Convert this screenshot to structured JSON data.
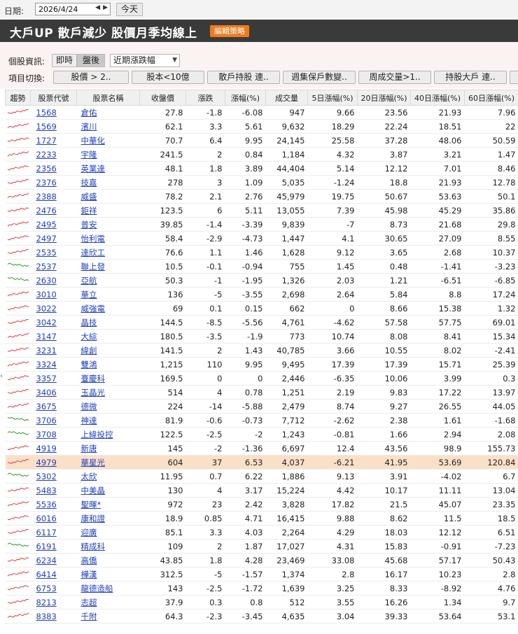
{
  "datebar": {
    "label": "日期:",
    "date": "2026/4/24",
    "today": "今天"
  },
  "title": {
    "text": "大戶UP 散戶減少 股價月季均線上",
    "edit": "編輯策略"
  },
  "info": {
    "label": "個股資訊:",
    "realtime": "即時",
    "afterhours": "盤後",
    "select": "近期漲跌幅"
  },
  "switch": {
    "label": "項目切換:",
    "buttons": [
      "股價 > 2..",
      "股本<10億",
      "散戶持股 連..",
      "週集保戶數變..",
      "周成交量>1..",
      "持股大戶 連.."
    ]
  },
  "columns": [
    "趨勢",
    "股票代號",
    "股票名稱",
    "收盤價",
    "漲跌",
    "漲幅(%)",
    "成交量",
    "5日漲幅(%)",
    "20日漲幅(%)",
    "40日漲幅(%)",
    "60日漲幅(%)"
  ],
  "colors": {
    "up": "#e23a3a",
    "down": "#2a9a2a",
    "highlight": "#fbe0c8",
    "accent": "#f07a1c"
  },
  "rows": [
    {
      "code": "1568",
      "name": "倉佑",
      "close": "27.8",
      "chg": "-1.8",
      "pct": "-6.08",
      "vol": "947",
      "d5": "9.66",
      "d20": "23.56",
      "d40": "21.93",
      "d60": "7.96",
      "trend": "up"
    },
    {
      "code": "1569",
      "name": "濱川",
      "close": "62.1",
      "chg": "3.3",
      "pct": "5.61",
      "vol": "9,632",
      "d5": "18.29",
      "d20": "22.24",
      "d40": "18.51",
      "d60": "22",
      "trend": "up"
    },
    {
      "code": "1727",
      "name": "中華化",
      "close": "70.7",
      "chg": "6.4",
      "pct": "9.95",
      "vol": "24,145",
      "d5": "25.58",
      "d20": "37.28",
      "d40": "48.06",
      "d60": "50.59",
      "trend": "up"
    },
    {
      "code": "2233",
      "name": "宇隆",
      "close": "241.5",
      "chg": "2",
      "pct": "0.84",
      "vol": "1,184",
      "d5": "4.32",
      "d20": "3.87",
      "d40": "3.21",
      "d60": "1.47",
      "trend": "up"
    },
    {
      "code": "2356",
      "name": "英業達",
      "close": "48.1",
      "chg": "1.8",
      "pct": "3.89",
      "vol": "44,404",
      "d5": "5.14",
      "d20": "12.12",
      "d40": "7.01",
      "d60": "8.46",
      "trend": "up"
    },
    {
      "code": "2376",
      "name": "技嘉",
      "close": "278",
      "chg": "3",
      "pct": "1.09",
      "vol": "5,035",
      "d5": "-1.24",
      "d20": "18.8",
      "d40": "21.93",
      "d60": "12.78",
      "trend": "up"
    },
    {
      "code": "2388",
      "name": "威盛",
      "close": "78.2",
      "chg": "2.1",
      "pct": "2.76",
      "vol": "45,979",
      "d5": "19.75",
      "d20": "50.67",
      "d40": "53.63",
      "d60": "50.1",
      "trend": "up"
    },
    {
      "code": "2476",
      "name": "鉅祥",
      "close": "123.5",
      "chg": "6",
      "pct": "5.11",
      "vol": "13,055",
      "d5": "7.39",
      "d20": "45.98",
      "d40": "45.29",
      "d60": "35.86",
      "trend": "up"
    },
    {
      "code": "2495",
      "name": "普安",
      "close": "39.85",
      "chg": "-1.4",
      "pct": "-3.39",
      "vol": "9,839",
      "d5": "-7",
      "d20": "8.73",
      "d40": "21.68",
      "d60": "29.8",
      "trend": "up"
    },
    {
      "code": "2497",
      "name": "怡利電",
      "close": "58.4",
      "chg": "-2.9",
      "pct": "-4.73",
      "vol": "1,447",
      "d5": "4.1",
      "d20": "30.65",
      "d40": "27.09",
      "d60": "8.55",
      "trend": "up"
    },
    {
      "code": "2535",
      "name": "達欣工",
      "close": "76.6",
      "chg": "1.1",
      "pct": "1.46",
      "vol": "1,628",
      "d5": "9.12",
      "d20": "3.65",
      "d40": "2.68",
      "d60": "10.37",
      "trend": "up"
    },
    {
      "code": "2537",
      "name": "聯上發",
      "close": "10.5",
      "chg": "-0.1",
      "pct": "-0.94",
      "vol": "755",
      "d5": "1.45",
      "d20": "0.48",
      "d40": "-1.41",
      "d60": "-3.23",
      "trend": "down"
    },
    {
      "code": "2630",
      "name": "亞航",
      "close": "50.3",
      "chg": "-1",
      "pct": "-1.95",
      "vol": "1,326",
      "d5": "2.03",
      "d20": "1.21",
      "d40": "-6.51",
      "d60": "-6.85",
      "trend": "down"
    },
    {
      "code": "3010",
      "name": "華立",
      "close": "136",
      "chg": "-5",
      "pct": "-3.55",
      "vol": "2,698",
      "d5": "2.64",
      "d20": "5.84",
      "d40": "8.8",
      "d60": "17.24",
      "trend": "up"
    },
    {
      "code": "3022",
      "name": "威強電",
      "close": "69",
      "chg": "0.1",
      "pct": "0.15",
      "vol": "662",
      "d5": "0",
      "d20": "8.66",
      "d40": "15.38",
      "d60": "1.32",
      "trend": "up"
    },
    {
      "code": "3042",
      "name": "晶技",
      "close": "144.5",
      "chg": "-8.5",
      "pct": "-5.56",
      "vol": "4,761",
      "d5": "-4.62",
      "d20": "57.58",
      "d40": "57.75",
      "d60": "69.01",
      "trend": "up"
    },
    {
      "code": "3147",
      "name": "大綜",
      "close": "180.5",
      "chg": "-3.5",
      "pct": "-1.9",
      "vol": "773",
      "d5": "10.74",
      "d20": "8.08",
      "d40": "8.41",
      "d60": "15.34",
      "trend": "up"
    },
    {
      "code": "3231",
      "name": "緯創",
      "close": "141.5",
      "chg": "2",
      "pct": "1.43",
      "vol": "40,785",
      "d5": "3.66",
      "d20": "10.55",
      "d40": "8.02",
      "d60": "-2.41",
      "trend": "up"
    },
    {
      "code": "3324",
      "name": "雙鴻",
      "close": "1,215",
      "chg": "110",
      "pct": "9.95",
      "vol": "9,495",
      "d5": "17.39",
      "d20": "17.39",
      "d40": "15.71",
      "d60": "25.39",
      "trend": "up"
    },
    {
      "code": "3357",
      "name": "臺慶科",
      "close": "169.5",
      "chg": "0",
      "pct": "0",
      "vol": "2,446",
      "d5": "-6.35",
      "d20": "10.06",
      "d40": "3.99",
      "d60": "0.3",
      "trend": "up"
    },
    {
      "code": "3406",
      "name": "玉晶光",
      "close": "514",
      "chg": "4",
      "pct": "0.78",
      "vol": "1,251",
      "d5": "2.19",
      "d20": "9.83",
      "d40": "17.22",
      "d60": "13.97",
      "trend": "up"
    },
    {
      "code": "3675",
      "name": "德微",
      "close": "224",
      "chg": "-14",
      "pct": "-5.88",
      "vol": "2,479",
      "d5": "8.74",
      "d20": "9.27",
      "d40": "26.55",
      "d60": "44.05",
      "trend": "up"
    },
    {
      "code": "3706",
      "name": "神達",
      "close": "81.9",
      "chg": "-0.6",
      "pct": "-0.73",
      "vol": "7,712",
      "d5": "-2.62",
      "d20": "2.38",
      "d40": "1.61",
      "d60": "-1.68",
      "trend": "down"
    },
    {
      "code": "3708",
      "name": "上緯投控",
      "close": "122.5",
      "chg": "-2.5",
      "pct": "-2",
      "vol": "1,243",
      "d5": "-0.81",
      "d20": "1.66",
      "d40": "2.94",
      "d60": "2.08",
      "trend": "down"
    },
    {
      "code": "4919",
      "name": "新唐",
      "close": "145",
      "chg": "-2",
      "pct": "-1.36",
      "vol": "6,697",
      "d5": "12.4",
      "d20": "43.56",
      "d40": "98.9",
      "d60": "155.73",
      "trend": "up"
    },
    {
      "code": "4979",
      "name": "華星光",
      "close": "604",
      "chg": "37",
      "pct": "6.53",
      "vol": "4,037",
      "d5": "-6.21",
      "d20": "41.95",
      "d40": "53.69",
      "d60": "120.84",
      "trend": "up",
      "highlight": true
    },
    {
      "code": "5302",
      "name": "太欣",
      "close": "11.95",
      "chg": "0.7",
      "pct": "6.22",
      "vol": "1,886",
      "d5": "9.13",
      "d20": "3.91",
      "d40": "-4.02",
      "d60": "6.7",
      "trend": "down"
    },
    {
      "code": "5483",
      "name": "中美晶",
      "close": "130",
      "chg": "4",
      "pct": "3.17",
      "vol": "15,224",
      "d5": "4.42",
      "d20": "10.17",
      "d40": "11.11",
      "d60": "13.04",
      "trend": "up"
    },
    {
      "code": "5536",
      "name": "聖暉*",
      "close": "972",
      "chg": "23",
      "pct": "2.42",
      "vol": "3,828",
      "d5": "17.82",
      "d20": "21.5",
      "d40": "45.07",
      "d60": "23.35",
      "trend": "up"
    },
    {
      "code": "6016",
      "name": "康和證",
      "close": "18.9",
      "chg": "0.85",
      "pct": "4.71",
      "vol": "16,415",
      "d5": "9.88",
      "d20": "8.62",
      "d40": "11.5",
      "d60": "18.5",
      "trend": "up"
    },
    {
      "code": "6117",
      "name": "迎廣",
      "close": "85.1",
      "chg": "3.3",
      "pct": "4.03",
      "vol": "2,264",
      "d5": "4.29",
      "d20": "18.03",
      "d40": "12.12",
      "d60": "6.51",
      "trend": "up"
    },
    {
      "code": "6191",
      "name": "精成科",
      "close": "109",
      "chg": "2",
      "pct": "1.87",
      "vol": "17,027",
      "d5": "4.31",
      "d20": "15.83",
      "d40": "-0.91",
      "d60": "-7.23",
      "trend": "down"
    },
    {
      "code": "6234",
      "name": "高僑",
      "close": "43.85",
      "chg": "1.8",
      "pct": "4.28",
      "vol": "23,469",
      "d5": "33.08",
      "d20": "45.68",
      "d40": "57.17",
      "d60": "50.43",
      "trend": "up"
    },
    {
      "code": "6414",
      "name": "樺漢",
      "close": "312.5",
      "chg": "-5",
      "pct": "-1.57",
      "vol": "1,374",
      "d5": "2.8",
      "d20": "16.17",
      "d40": "10.23",
      "d60": "2.8",
      "trend": "up"
    },
    {
      "code": "6753",
      "name": "龍德造船",
      "close": "143",
      "chg": "-2.5",
      "pct": "-1.72",
      "vol": "1,639",
      "d5": "3.25",
      "d20": "8.33",
      "d40": "-8.92",
      "d60": "4.76",
      "trend": "up"
    },
    {
      "code": "8213",
      "name": "志超",
      "close": "37.9",
      "chg": "0.3",
      "pct": "0.8",
      "vol": "512",
      "d5": "3.55",
      "d20": "16.26",
      "d40": "1.34",
      "d60": "9.7",
      "trend": "up"
    },
    {
      "code": "8383",
      "name": "千附",
      "close": "64.3",
      "chg": "-2.3",
      "pct": "-3.45",
      "vol": "4,635",
      "d5": "3.04",
      "d20": "39.33",
      "d40": "53.64",
      "d60": "53.1",
      "trend": "up"
    }
  ]
}
